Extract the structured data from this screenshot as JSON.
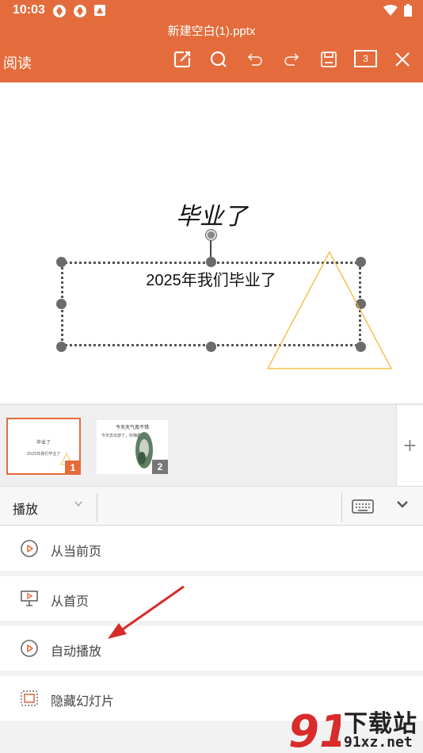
{
  "status": {
    "time": "10:03"
  },
  "header": {
    "file_title": "新建空白(1).pptx",
    "read_mode": "阅读",
    "page_count": "3",
    "bg_color": "#e46c3c"
  },
  "slide": {
    "title": "毕业了",
    "subtitle": "2025年我们毕业了"
  },
  "thumbnails": [
    {
      "number": "1",
      "title": "毕业了",
      "subtitle": "2025年我们毕业了"
    },
    {
      "number": "2",
      "title": "今天天气真不错",
      "subtitle": "今天去出游了，好嗨森"
    }
  ],
  "toolbar": {
    "mode": "播放"
  },
  "menu": {
    "items": [
      {
        "label": "从当前页",
        "icon": "play-circle-icon"
      },
      {
        "label": "从首页",
        "icon": "presentation-icon"
      },
      {
        "label": "自动播放",
        "icon": "play-circle-icon"
      },
      {
        "label": "隐藏幻灯片",
        "icon": "hidden-slide-icon"
      }
    ]
  },
  "watermark": {
    "text": "下载站",
    "url": "91xz.net",
    "logo": "91"
  }
}
